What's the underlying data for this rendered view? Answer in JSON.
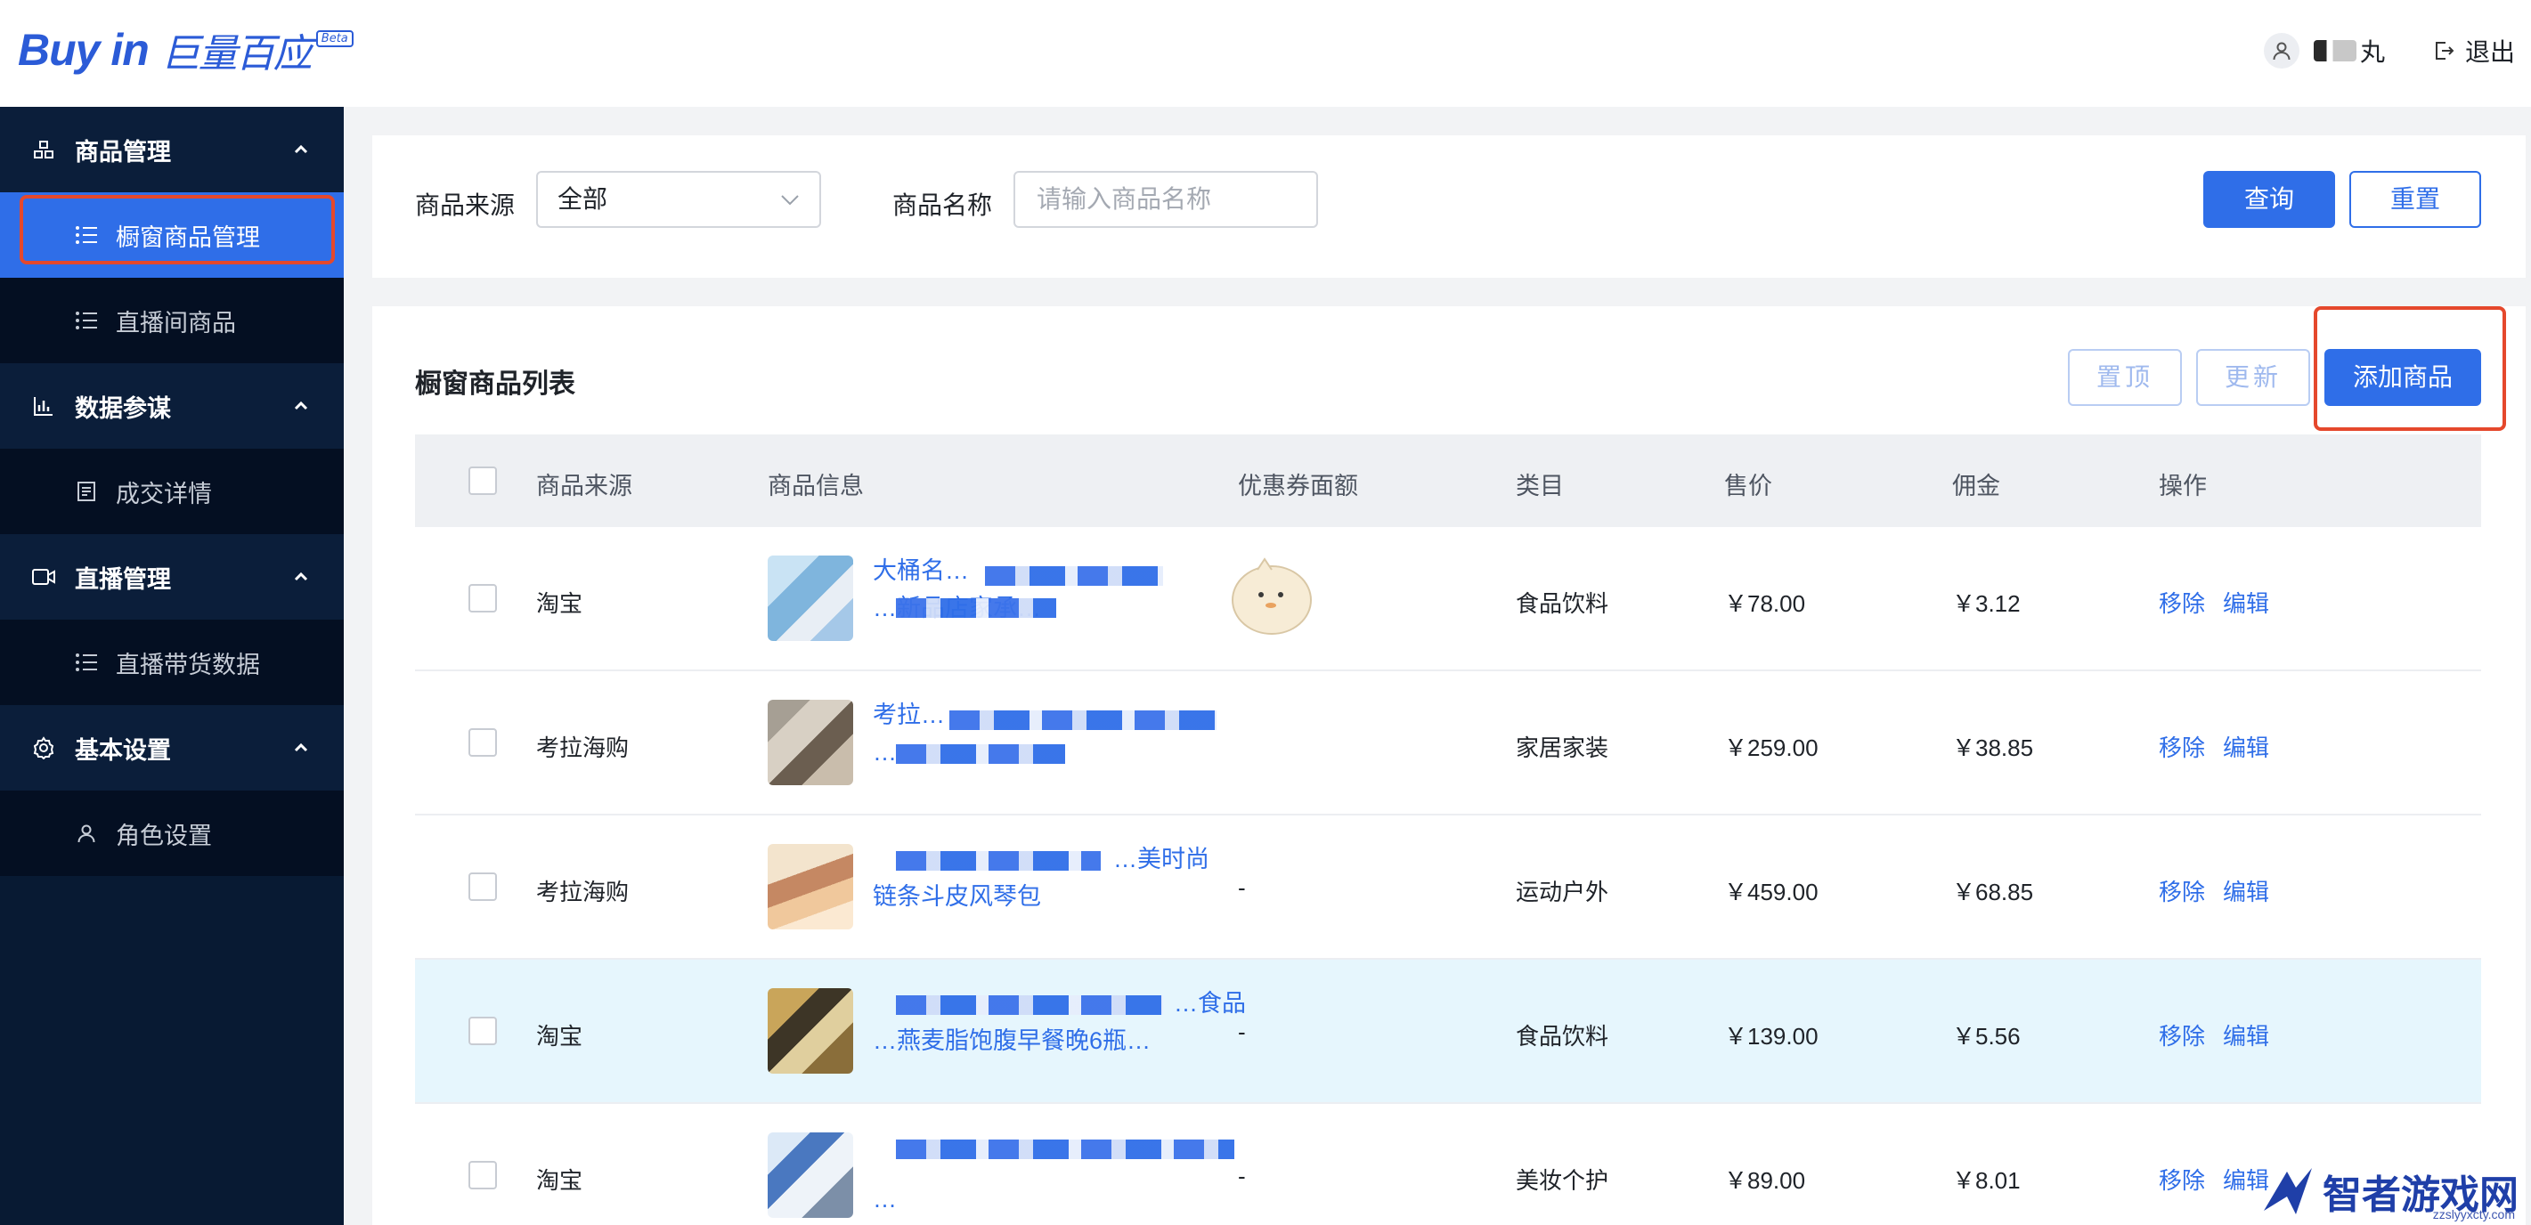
{
  "header": {
    "logo_text": "Buy in",
    "logo_cn": "巨量百应",
    "logo_badge": "Beta",
    "user_name": "丸",
    "logout_label": "退出"
  },
  "sidebar": {
    "groups": [
      {
        "label": "商品管理",
        "icon": "product-icon",
        "items": [
          {
            "label": "橱窗商品管理",
            "active": true
          },
          {
            "label": "直播间商品",
            "active": false
          }
        ]
      },
      {
        "label": "数据参谋",
        "icon": "chart-icon",
        "items": [
          {
            "label": "成交详情",
            "active": false
          }
        ]
      },
      {
        "label": "直播管理",
        "icon": "camera-icon",
        "items": [
          {
            "label": "直播带货数据",
            "active": false
          }
        ]
      },
      {
        "label": "基本设置",
        "icon": "gear-icon",
        "items": [
          {
            "label": "角色设置",
            "active": false
          }
        ]
      }
    ]
  },
  "filter": {
    "source_label": "商品来源",
    "source_value": "全部",
    "name_label": "商品名称",
    "name_placeholder": "请输入商品名称",
    "query_button": "查询",
    "reset_button": "重置"
  },
  "list": {
    "title": "橱窗商品列表",
    "pin_button": "置顶",
    "update_button": "更新",
    "add_button": "添加商品",
    "columns": [
      "商品来源",
      "商品信息",
      "优惠券面额",
      "类目",
      "售价",
      "佣金",
      "操作"
    ],
    "rows": [
      {
        "source": "淘宝",
        "title1": "大桶名…",
        "title2": "…新品店家承…",
        "coupon": "",
        "category": "食品饮料",
        "price": "￥78.00",
        "commission": "￥3.12",
        "remove": "移除",
        "edit": "编辑"
      },
      {
        "source": "考拉海购",
        "title1": "考拉…",
        "title2": "…",
        "coupon": "",
        "category": "家居家装",
        "price": "￥259.00",
        "commission": "￥38.85",
        "remove": "移除",
        "edit": "编辑"
      },
      {
        "source": "考拉海购",
        "title1": "…美时尚",
        "title2": "链条斗皮风琴包",
        "coupon": "-",
        "category": "运动户外",
        "price": "￥459.00",
        "commission": "￥68.85",
        "remove": "移除",
        "edit": "编辑"
      },
      {
        "source": "淘宝",
        "title1": "…食品",
        "title2": "…燕麦脂饱腹早餐晚6瓶…",
        "coupon": "-",
        "category": "食品饮料",
        "price": "￥139.00",
        "commission": "￥5.56",
        "remove": "移除",
        "edit": "编辑"
      },
      {
        "source": "淘宝",
        "title1": "",
        "title2": "…",
        "coupon": "-",
        "category": "美妆个护",
        "price": "￥89.00",
        "commission": "￥8.01",
        "remove": "移除",
        "edit": "编辑"
      }
    ]
  },
  "watermark": {
    "text": "智者游戏网",
    "sub": "zzslyyxcty.com"
  }
}
